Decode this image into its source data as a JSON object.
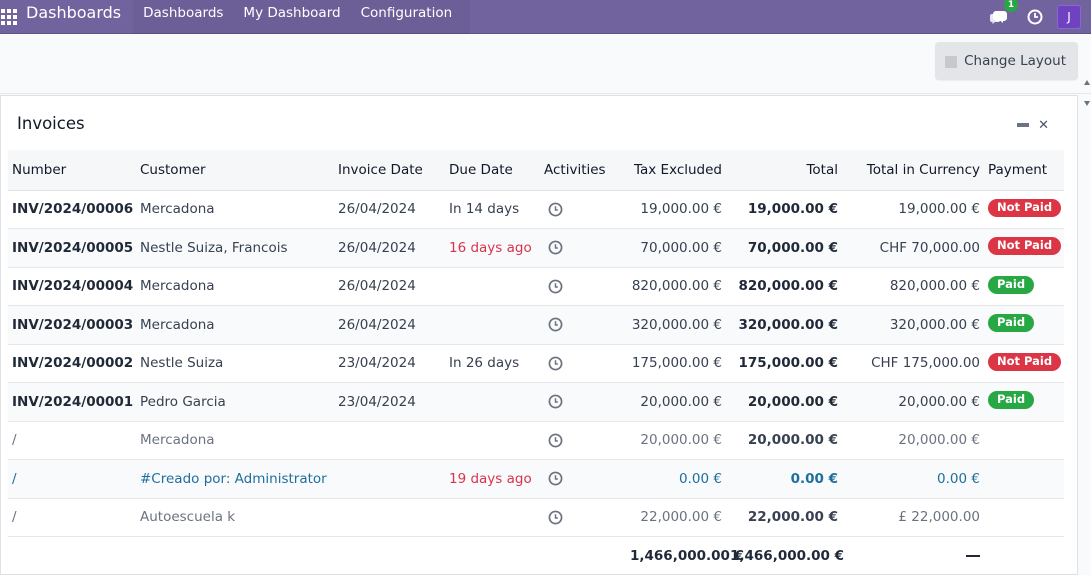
{
  "navbar": {
    "brand": "Dashboards",
    "menu": [
      "Dashboards",
      "My Dashboard",
      "Configuration"
    ],
    "chat_badge": "1",
    "avatar_letter": "J",
    "color": "#71639e"
  },
  "control": {
    "change_layout_label": "Change Layout"
  },
  "card": {
    "title": "Invoices",
    "columns": {
      "number": "Number",
      "customer": "Customer",
      "invoice_date": "Invoice Date",
      "due_date": "Due Date",
      "activities": "Activities",
      "tax_excluded": "Tax Excluded",
      "total": "Total",
      "total_currency": "Total in Currency",
      "payment": "Payment"
    },
    "rows": [
      {
        "number": "INV/2024/00006",
        "customer": "Mercadona",
        "invoice_date": "26/04/2024",
        "due_date": "In 14 days",
        "tax_excluded": "19,000.00 €",
        "total": "19,000.00 €",
        "total_currency": "19,000.00 €",
        "payment": "Not Paid"
      },
      {
        "number": "INV/2024/00005",
        "customer": "Nestle Suiza, Francois",
        "invoice_date": "26/04/2024",
        "due_date": "16 days ago",
        "tax_excluded": "70,000.00 €",
        "total": "70,000.00 €",
        "total_currency": "CHF 70,000.00",
        "payment": "Not Paid"
      },
      {
        "number": "INV/2024/00004",
        "customer": "Mercadona",
        "invoice_date": "26/04/2024",
        "due_date": "",
        "tax_excluded": "820,000.00 €",
        "total": "820,000.00 €",
        "total_currency": "820,000.00 €",
        "payment": "Paid"
      },
      {
        "number": "INV/2024/00003",
        "customer": "Mercadona",
        "invoice_date": "26/04/2024",
        "due_date": "",
        "tax_excluded": "320,000.00 €",
        "total": "320,000.00 €",
        "total_currency": "320,000.00 €",
        "payment": "Paid"
      },
      {
        "number": "INV/2024/00002",
        "customer": "Nestle Suiza",
        "invoice_date": "23/04/2024",
        "due_date": "In 26 days",
        "tax_excluded": "175,000.00 €",
        "total": "175,000.00 €",
        "total_currency": "CHF 175,000.00",
        "payment": "Not Paid"
      },
      {
        "number": "INV/2024/00001",
        "customer": "Pedro Garcia",
        "invoice_date": "23/04/2024",
        "due_date": "",
        "tax_excluded": "20,000.00 €",
        "total": "20,000.00 €",
        "total_currency": "20,000.00 €",
        "payment": "Paid"
      },
      {
        "number": "/",
        "customer": "Mercadona",
        "invoice_date": "",
        "due_date": "",
        "tax_excluded": "20,000.00 €",
        "total": "20,000.00 €",
        "total_currency": "20,000.00 €",
        "payment": ""
      },
      {
        "number": "/",
        "customer": "#Creado por: Administrator",
        "invoice_date": "",
        "due_date": "19 days ago",
        "tax_excluded": "0.00 €",
        "total": "0.00 €",
        "total_currency": "0.00 €",
        "payment": ""
      },
      {
        "number": "/",
        "customer": "Autoescuela k",
        "invoice_date": "",
        "due_date": "",
        "tax_excluded": "22,000.00 €",
        "total": "22,000.00 €",
        "total_currency": "£ 22,000.00",
        "payment": ""
      }
    ],
    "footer": {
      "tax_excluded": "1,466,000.00 €",
      "total": "1,466,000.00 €"
    }
  },
  "colors": {
    "not_paid": "#dc3545",
    "paid": "#28a745",
    "overdue": "#d9334d",
    "link": "#1e6f9e"
  }
}
